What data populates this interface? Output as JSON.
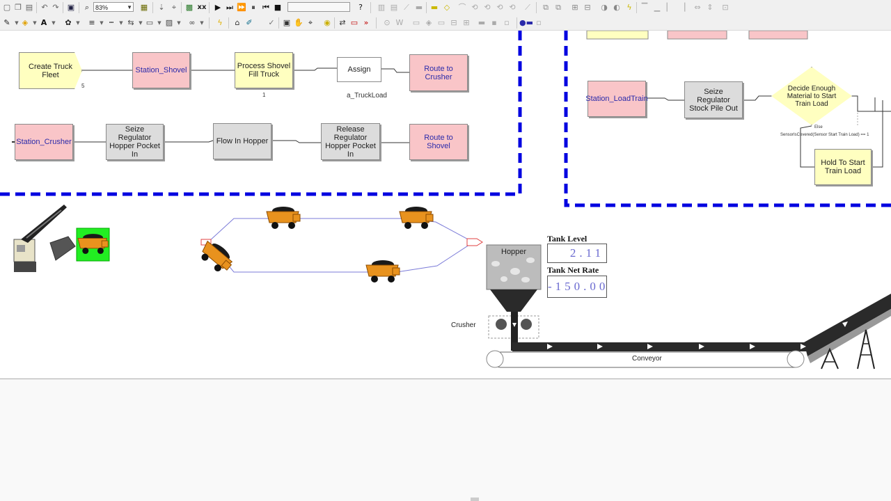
{
  "toolbar": {
    "zoom_value": "83%",
    "icons_row1": [
      "new-icon",
      "copy-icon",
      "paste-icon",
      "undo-icon",
      "redo-icon",
      "view-icon",
      "zoom-icon",
      "layers-icon",
      "arrow-icon",
      "search-icon",
      "report-icon",
      "xx-icon",
      "run-icon",
      "step-icon",
      "fast-forward-icon",
      "pause-icon",
      "go-to-start-icon",
      "stop-icon",
      "animation-slider",
      "help-icon"
    ],
    "icons_row2": [
      "line-color-icon",
      "fill-color-icon",
      "text-color-icon",
      "style-icon",
      "line-width-icon",
      "line-style-icon",
      "arrow-style-icon",
      "pattern-icon",
      "fill-pattern-icon",
      "link-icon",
      "lightning-icon",
      "open-icon",
      "edit-icon",
      "check-icon",
      "select-icon",
      "hand-icon",
      "pan-icon",
      "route-icon",
      "station-icon",
      "chevron-icon"
    ]
  },
  "flowchart": {
    "modules": {
      "create_truck_fleet": "Create Truck Fleet",
      "create_truck_fleet_count": "5",
      "station_shovel": "Station_Shovel",
      "process_shovel": "Process Shovel Fill Truck",
      "process_shovel_count": "1",
      "assign": "Assign",
      "assign_sub": "a_TruckLoad",
      "route_to_crusher": "Route to Crusher",
      "station_crusher": "Station_Crusher",
      "seize_regulator_hopper": "Seize Regulator Hopper Pocket In",
      "flow_in_hopper": "Flow In Hopper",
      "release_regulator": "Release Regulator Hopper Pocket In",
      "route_to_shovel": "Route to Shovel",
      "station_loadtrain": "Station_LoadTrain",
      "seize_regulator_stock": "Seize Regulator Stock Pile Out",
      "decide": "Decide Enough Material to Start Train Load",
      "decide_else": "Else",
      "decide_condition": "SensorIsCovered(Sensor Start Train Load) == 1",
      "hold": "Hold To Start Train Load"
    }
  },
  "animation": {
    "tank_level_label": "Tank Level",
    "tank_level_value": "2.11",
    "tank_rate_label": "Tank Net Rate",
    "tank_rate_value": "-150.00",
    "hopper_label": "Hopper",
    "crusher_label": "Crusher",
    "conveyor_label": "Conveyor"
  },
  "colors": {
    "dashed_border": "#0000e0",
    "module_yellow": "#ffffc0",
    "module_pink": "#f9c5c8",
    "module_gray": "#dcdcdc",
    "truck": "#e8921e",
    "route_line": "#7b7bd8"
  }
}
